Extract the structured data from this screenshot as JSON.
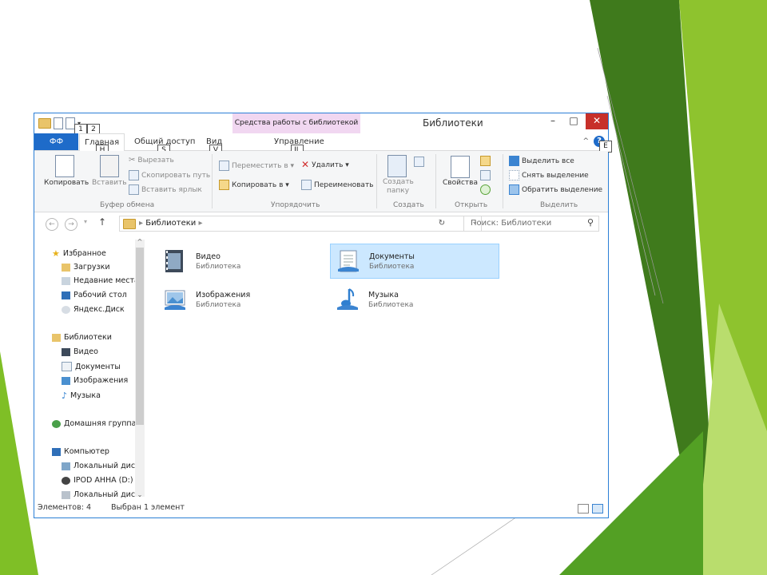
{
  "window": {
    "title": "Библиотеки",
    "contextual_tab_title": "Средства работы с библиотекой",
    "minimize": "–",
    "maximize": "□",
    "close": "✕"
  },
  "tabs": {
    "file": "ФФ",
    "home": "Главная",
    "share": "Общий доступ",
    "view": "Вид",
    "manage": "Управление"
  },
  "keytips": {
    "qat1": "1",
    "qat2": "2",
    "home": "H",
    "share": "S",
    "view": "V",
    "manage": "JL",
    "expand": "E"
  },
  "ribbon": {
    "clipboard": {
      "copy": "Копировать",
      "paste": "Вставить",
      "cut": "Вырезать",
      "copy_path": "Скопировать путь",
      "paste_shortcut": "Вставить ярлык",
      "group": "Буфер обмена"
    },
    "organize": {
      "move_to": "Переместить в ▾",
      "copy_to": "Копировать в ▾",
      "delete": "Удалить ▾",
      "rename": "Переименовать",
      "group": "Упорядочить"
    },
    "new": {
      "new_folder_line1": "Создать",
      "new_folder_line2": "папку",
      "group": "Создать"
    },
    "open": {
      "properties": "Свойства",
      "group": "Открыть"
    },
    "select": {
      "select_all": "Выделить все",
      "select_none": "Снять выделение",
      "invert": "Обратить выделение",
      "group": "Выделить"
    }
  },
  "address": {
    "path": "Библиотеки",
    "search_placeholder": "Поиск: Библиотеки"
  },
  "nav": {
    "favorites": "Избранное",
    "downloads": "Загрузки",
    "recent": "Недавние места",
    "desktop": "Рабочий стол",
    "yadisk": "Яндекс.Диск",
    "libraries": "Библиотеки",
    "video": "Видео",
    "documents": "Документы",
    "pictures": "Изображения",
    "music": "Музыка",
    "homegroup": "Домашняя группа",
    "computer": "Компьютер",
    "local_disk_c": "Локальный диск",
    "ipod": "IPOD АННА (D:)",
    "local_disk_2": "Локальный диск"
  },
  "libraries": [
    {
      "name": "Видео",
      "type": "Библиотека",
      "icon": "video-library-icon",
      "selected": false
    },
    {
      "name": "Документы",
      "type": "Библиотека",
      "icon": "documents-library-icon",
      "selected": true
    },
    {
      "name": "Изображения",
      "type": "Библиотека",
      "icon": "pictures-library-icon",
      "selected": false
    },
    {
      "name": "Музыка",
      "type": "Библиотека",
      "icon": "music-library-icon",
      "selected": false
    }
  ],
  "status": {
    "items": "Элементов: 4",
    "selected": "Выбран 1 элемент"
  },
  "colors": {
    "accent": "#1e6bc9",
    "contextual_tab": "#f1d7f1",
    "close_button": "#c7302a",
    "selection": "#cce8ff",
    "slide_green_dark": "#3f7a1c",
    "slide_green": "#7fbf26",
    "slide_green_light": "#b9dd6d"
  }
}
